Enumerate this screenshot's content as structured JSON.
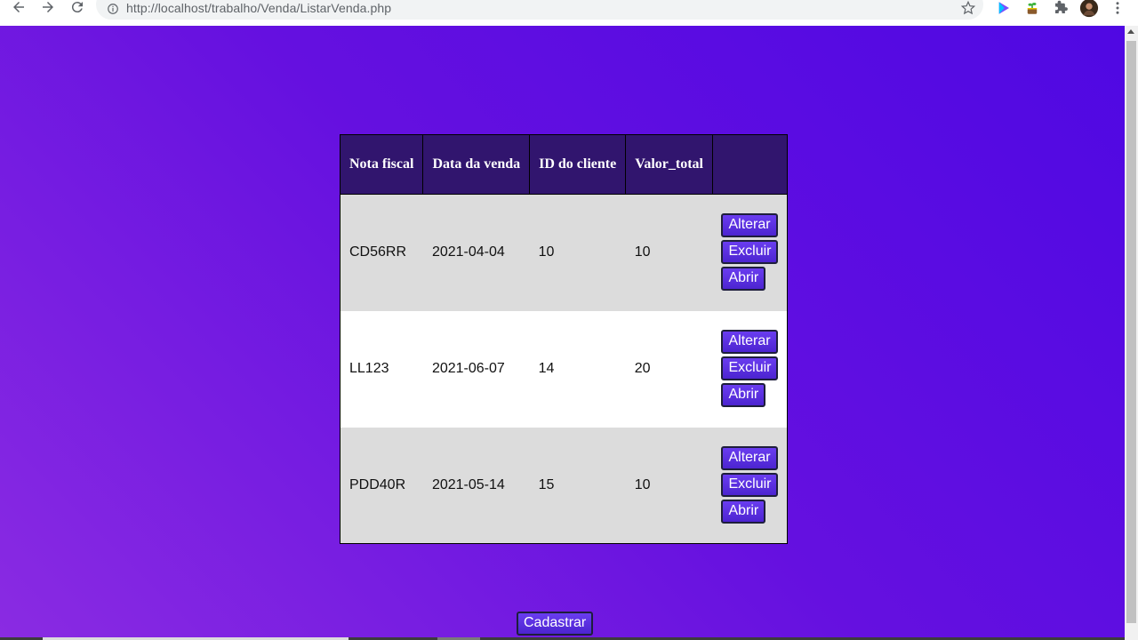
{
  "browser": {
    "url": "http://localhost/trabalho/Venda/ListarVenda.php"
  },
  "table": {
    "headers": [
      "Nota fiscal",
      "Data da venda",
      "ID do cliente",
      "Valor_total",
      ""
    ],
    "rows": [
      {
        "nota_fiscal": "CD56RR",
        "data_venda": "2021-04-04",
        "id_cliente": "10",
        "valor_total": "10"
      },
      {
        "nota_fiscal": "LL123",
        "data_venda": "2021-06-07",
        "id_cliente": "14",
        "valor_total": "20"
      },
      {
        "nota_fiscal": "PDD40R",
        "data_venda": "2021-05-14",
        "id_cliente": "15",
        "valor_total": "10"
      }
    ],
    "actions": {
      "alterar": "Alterar",
      "excluir": "Excluir",
      "abrir": "Abrir"
    }
  },
  "cadastrar_label": "Cadastrar",
  "colors": {
    "header_bg": "#31156e",
    "button_bg": "#5a2be0",
    "page_gradient_start": "#4f08e3",
    "page_gradient_end": "#8a2be2"
  }
}
